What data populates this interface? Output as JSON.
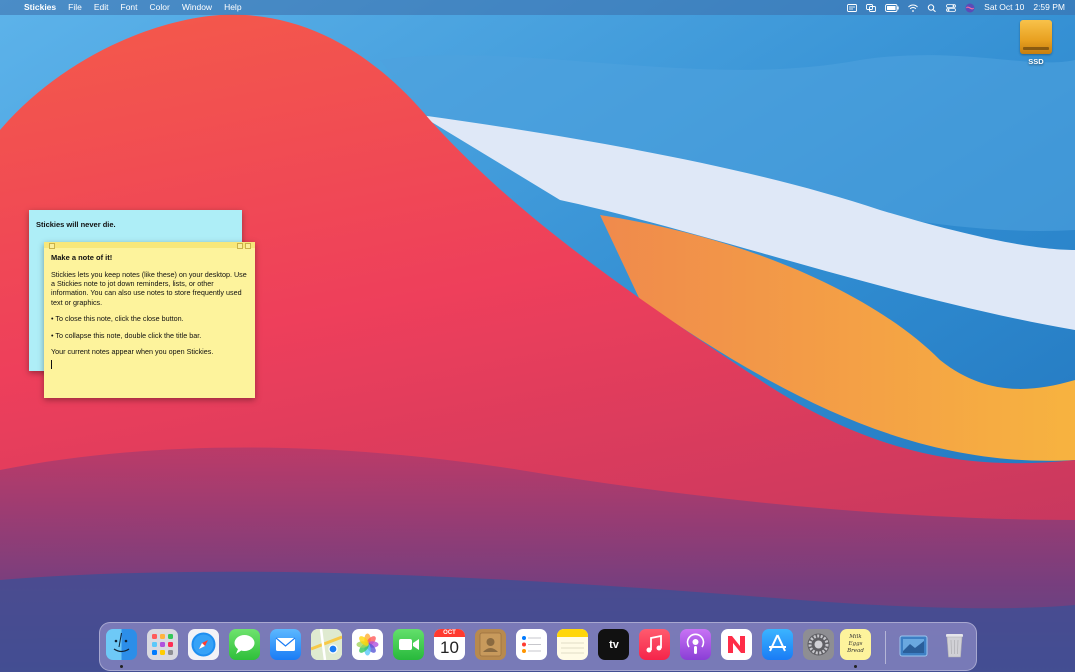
{
  "menubar": {
    "apple_symbol": "",
    "app_name": "Stickies",
    "menus": [
      "File",
      "Edit",
      "Font",
      "Color",
      "Window",
      "Help"
    ],
    "status_icons": [
      "input-menu-icon",
      "screen-mirroring-icon",
      "battery-icon",
      "wifi-icon",
      "spotlight-icon",
      "control-center-icon",
      "siri-icon"
    ],
    "date": "Sat Oct 10",
    "time": "2:59 PM"
  },
  "desktop": {
    "ssd_label": "SSD"
  },
  "notes": {
    "blue": {
      "text": "Stickies will never die.",
      "color": "#aeeef7"
    },
    "yellow": {
      "color": "#fdf39c",
      "title": "Make a note of it!",
      "para1": "Stickies lets you keep notes (like these) on your desktop. Use a Stickies note to jot down reminders, lists, or other information. You can also use notes to store frequently used text or graphics.",
      "para2": "• To close this note, click the close button.",
      "para3": "• To collapse this note, double click the title bar.",
      "para4": "Your current notes appear when you open Stickies."
    }
  },
  "dock": {
    "calendar_month": "OCT",
    "calendar_day": "10",
    "appletv_label": "tv",
    "stickies_lines": [
      "Milk",
      "Eggs",
      "Bread"
    ],
    "apps": [
      "Finder",
      "Launchpad",
      "Safari",
      "Messages",
      "Mail",
      "Maps",
      "Photos",
      "FaceTime",
      "Calendar",
      "Contacts",
      "Reminders",
      "Notes",
      "Apple TV",
      "Music",
      "Podcasts",
      "News",
      "App Store",
      "System Preferences",
      "Stickies",
      "Downloads",
      "Trash"
    ]
  }
}
